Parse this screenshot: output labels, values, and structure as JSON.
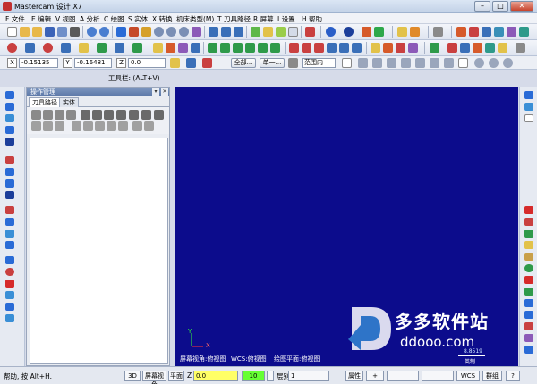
{
  "window": {
    "title": "Mastercam 设计 X7",
    "min": "–",
    "max": "□",
    "close": "✕"
  },
  "menu": [
    "F 文件",
    "E 编辑",
    "V 视图",
    "A 分析",
    "C 绘图",
    "S 实体",
    "X 转换",
    "机床类型(M)",
    "T 刀具路径",
    "R 屏幕",
    "I 设置",
    "H 帮助"
  ],
  "coords": {
    "x_label": "X",
    "x_value": "-0.15135",
    "y_label": "Y",
    "y_value": "-0.16481",
    "z_label": "Z",
    "z_value": "0.0",
    "btn_all": "全部...",
    "btn_single": "单一...",
    "range": "范围内"
  },
  "toolbar_label": "工具栏: (ALT+V)",
  "ops_panel": {
    "title": "操作管理",
    "tabs": [
      "刀具路径",
      "实体"
    ],
    "pin": "▾",
    "close": "✕"
  },
  "viewport": {
    "screen_view": "屏幕视角:俯视图",
    "wcs": "WCS:俯视图",
    "plane": "绘图平面:俯视图",
    "axis_x": "X",
    "axis_y": "Y",
    "scale_text": "8.8519",
    "scale_unit": "英制"
  },
  "watermark": {
    "brand_cn": "多多软件站",
    "domain": "ddooo.com"
  },
  "status": {
    "help": "帮助, 按 Alt+H.",
    "3d": "3D",
    "screen_view": "屏幕视角",
    "plane": "平面",
    "z_label": "Z",
    "z_value": "0.0",
    "level_value": "10",
    "level_label": "层别",
    "level_num": "1",
    "attr": "属性",
    "plus": "+",
    "wcs": "WCS",
    "group": "群组",
    "help_icon": "?"
  },
  "colors": {
    "viewport": "#0c0c8c",
    "accent": "#5b77a7",
    "z_field": "#ffff66",
    "level_field": "#66ff33"
  }
}
